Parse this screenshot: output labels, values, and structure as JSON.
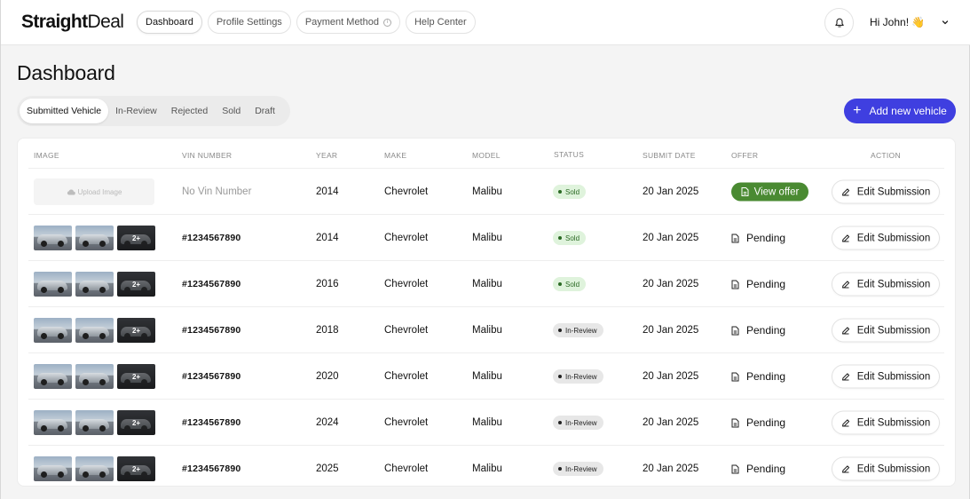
{
  "app": {
    "logo_bold": "Straight",
    "logo_light": "Deal",
    "nav": [
      {
        "label": "Dashboard"
      },
      {
        "label": "Profile Settings"
      },
      {
        "label": "Payment Method"
      },
      {
        "label": "Help Center"
      }
    ],
    "greeting": "Hi John! 👋",
    "icons": {
      "bell": "bell-icon",
      "chevron": "chevron-down-icon",
      "info": "info-icon"
    }
  },
  "page": {
    "title": "Dashboard",
    "tabs": [
      "Submitted Vehicle",
      "In-Review",
      "Rejected",
      "Sold",
      "Draft"
    ],
    "active_tab": "Submitted Vehicle",
    "add_button": "Add new vehicle"
  },
  "colors": {
    "primary": "#3f3fe0",
    "offer_green": "#4a8a32",
    "sold_bg": "#dff3dc",
    "sold_text": "#2b6a24",
    "review_bg": "#e7e7e7"
  },
  "table": {
    "headers": [
      "IMAGE",
      "VIN NUMBER",
      "YEAR",
      "MAKE",
      "MODEL",
      "STATUS",
      "SUBMIT DATE",
      "OFFER",
      "ACTION"
    ],
    "upload_label": "Upload Image",
    "more_images": "2+",
    "edit_label": "Edit Submission",
    "rows": [
      {
        "vin": "No Vin Number",
        "year": "2014",
        "make": "Chevrolet",
        "model": "Malibu",
        "status": "Sold",
        "date": "20 Jan 2025",
        "offer": "View offer"
      },
      {
        "vin": "#1234567890",
        "year": "2014",
        "make": "Chevrolet",
        "model": "Malibu",
        "status": "Sold",
        "date": "20 Jan 2025",
        "offer": "Pending"
      },
      {
        "vin": "#1234567890",
        "year": "2016",
        "make": "Chevrolet",
        "model": "Malibu",
        "status": "Sold",
        "date": "20 Jan 2025",
        "offer": "Pending"
      },
      {
        "vin": "#1234567890",
        "year": "2018",
        "make": "Chevrolet",
        "model": "Malibu",
        "status": "In-Review",
        "date": "20 Jan 2025",
        "offer": "Pending"
      },
      {
        "vin": "#1234567890",
        "year": "2020",
        "make": "Chevrolet",
        "model": "Malibu",
        "status": "In-Review",
        "date": "20 Jan 2025",
        "offer": "Pending"
      },
      {
        "vin": "#1234567890",
        "year": "2024",
        "make": "Chevrolet",
        "model": "Malibu",
        "status": "In-Review",
        "date": "20 Jan 2025",
        "offer": "Pending"
      },
      {
        "vin": "#1234567890",
        "year": "2025",
        "make": "Chevrolet",
        "model": "Malibu",
        "status": "In-Review",
        "date": "20 Jan 2025",
        "offer": "Pending"
      }
    ]
  }
}
